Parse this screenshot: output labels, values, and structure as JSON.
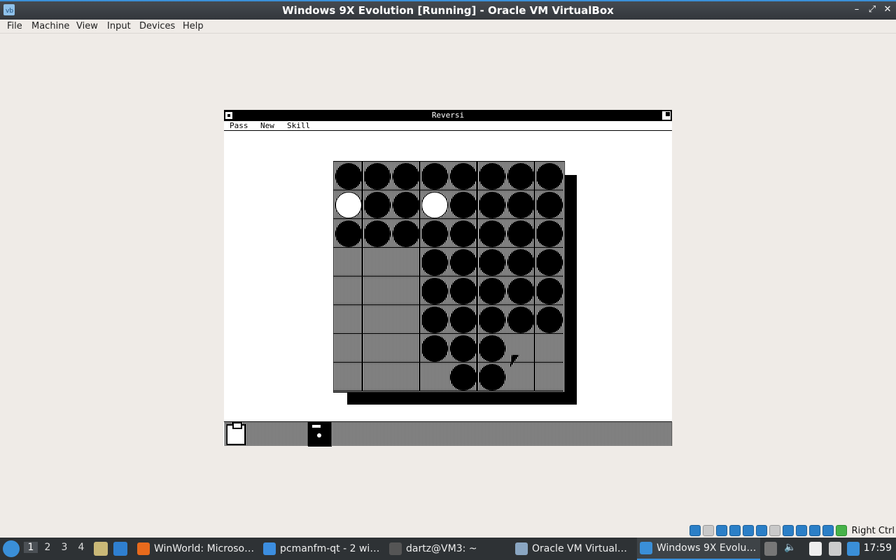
{
  "window": {
    "title": "Windows 9X Evolution [Running] - Oracle VM VirtualBox",
    "controls": {
      "minimize": "–",
      "restore": "⤢",
      "close": "✕"
    }
  },
  "menubar": [
    "File",
    "Machine",
    "View",
    "Input",
    "Devices",
    "Help"
  ],
  "guest": {
    "app_title": "Reversi",
    "menu": [
      "Pass",
      "New",
      "Skill"
    ],
    "board": [
      "BBBBBBBB",
      "WBBWBBBB",
      "BBBBBBBB",
      "...BBBBB",
      "...BBBBB",
      "...BBBBB",
      "...BBB..",
      "....BB.."
    ]
  },
  "vbox_status": {
    "host_key": "Right Ctrl"
  },
  "taskbar": {
    "desktops": [
      "1",
      "2",
      "3",
      "4"
    ],
    "active_desktop": "1",
    "tasks": [
      {
        "label": "WinWorld: Microso…",
        "color": "#e86a1c"
      },
      {
        "label": "pcmanfm-qt - 2 wi…",
        "color": "#3c8ee0"
      },
      {
        "label": "dartz@VM3: ~",
        "color": "#555555"
      },
      {
        "label": "Oracle VM Virtual…",
        "color": "#8aa6c2"
      },
      {
        "label": "Windows 9X Evolu…",
        "color": "#3a8fd8"
      }
    ],
    "clock": "17:59"
  }
}
